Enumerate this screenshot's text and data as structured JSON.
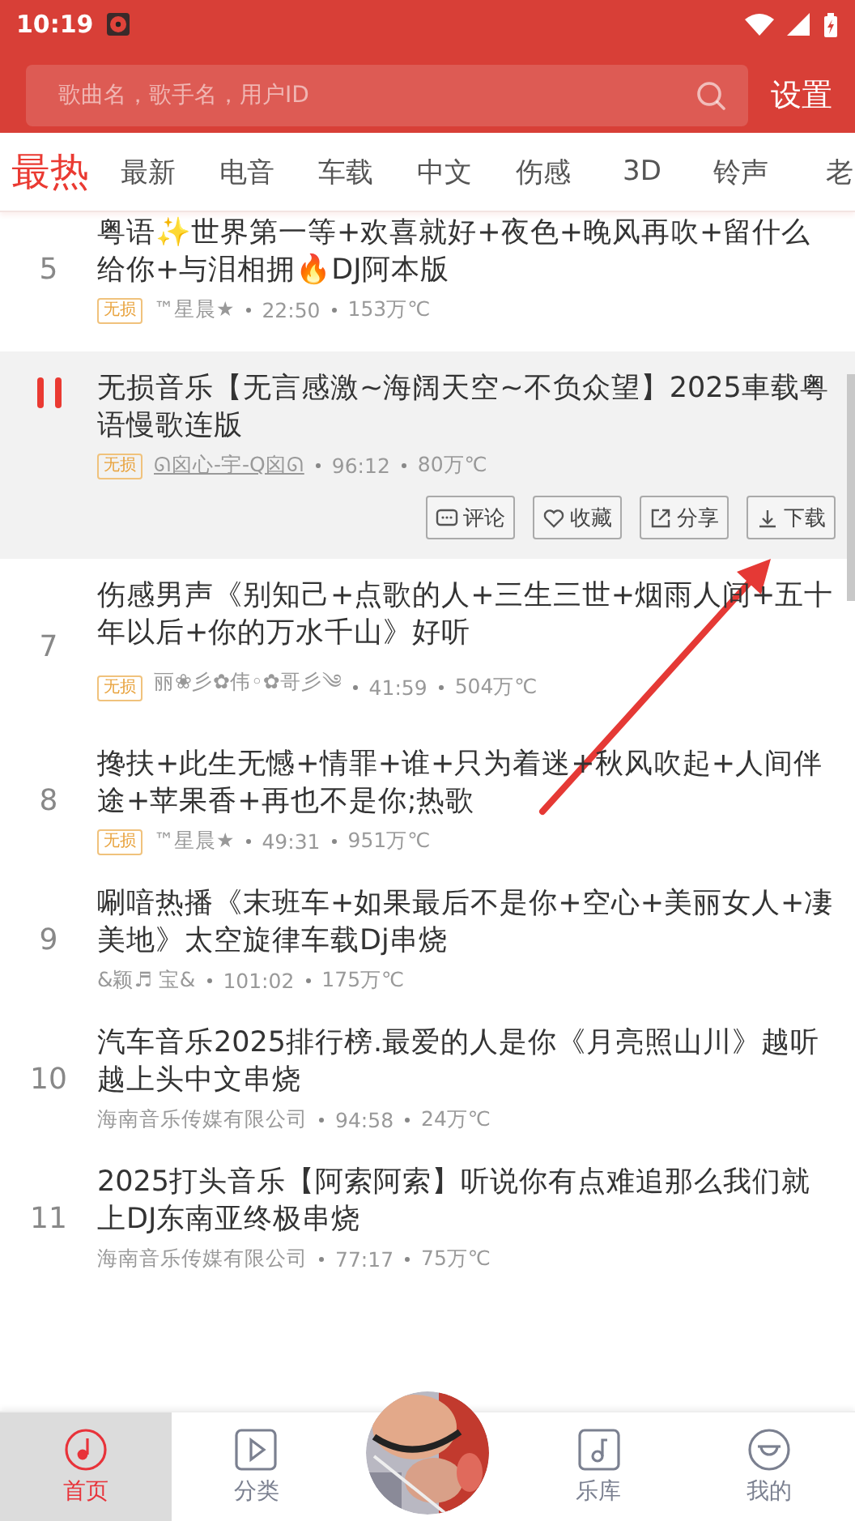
{
  "status_bar": {
    "time": "10:19"
  },
  "search": {
    "placeholder": "歌曲名，歌手名，用户ID",
    "action": "设置"
  },
  "tabs": [
    {
      "label": "最热",
      "selected": true
    },
    {
      "label": "最新",
      "selected": false
    },
    {
      "label": "电音",
      "selected": false
    },
    {
      "label": "车载",
      "selected": false
    },
    {
      "label": "中文",
      "selected": false
    },
    {
      "label": "伤感",
      "selected": false
    },
    {
      "label": "3D",
      "selected": false
    },
    {
      "label": "铃声",
      "selected": false
    },
    {
      "label": "老",
      "selected": false
    }
  ],
  "songs": [
    {
      "number": "5",
      "playing": false,
      "title": "粤语✨世界第一等+欢喜就好+夜色+晚风再吹+留什么给你+与泪相拥🔥DJ阿本版",
      "lossless": "无损",
      "uploader": "™星晨★",
      "duration": "22:50",
      "heat": "153万℃"
    },
    {
      "playing": true,
      "title": "无损音乐【无言感激~海阔天空~不负众望】2025車载粤语慢歌连版",
      "lossless": "无损",
      "uploader": "ᘏ囟心-宇-Q囟ᘏ",
      "duration": "96:12",
      "heat": "80万℃",
      "actions": [
        {
          "kind": "comment",
          "label": "评论"
        },
        {
          "kind": "heart",
          "label": "收藏"
        },
        {
          "kind": "share",
          "label": "分享"
        },
        {
          "kind": "download",
          "label": "下载"
        }
      ]
    },
    {
      "number": "7",
      "playing": false,
      "title": "伤感男声《别知己+点歌的人+三生三世+烟雨人间+五十年以后+你的万水千山》好听",
      "lossless": "无损",
      "uploader": "丽❀彡✿伟◦✿哥彡༄",
      "duration": "41:59",
      "heat": "504万℃"
    },
    {
      "number": "8",
      "playing": false,
      "title": "搀扶+此生无憾+情罪+谁+只为着迷+秋风吹起+人间伴途+苹果香+再也不是你;热歌",
      "lossless": "无损",
      "uploader": "™星晨★",
      "duration": "49:31",
      "heat": "951万℃"
    },
    {
      "number": "9",
      "playing": false,
      "title": "唰喑热播《末班车+如果最后不是你+空心+美丽女人+凄美地》太空旋律车载Dj串烧",
      "uploader": "&颖♬ 宝&",
      "duration": "101:02",
      "heat": "175万℃"
    },
    {
      "number": "10",
      "playing": false,
      "title": "汽车音乐2025排行榜.最爱的人是你《月亮照山川》越听越上头中文串烧",
      "uploader": "海南音乐传媒有限公司",
      "duration": "94:58",
      "heat": "24万℃"
    },
    {
      "number": "11",
      "playing": false,
      "title": "2025打头音乐【阿索阿索】听说你有点难追那么我们就上DJ东南亚终极串烧",
      "uploader": "海南音乐传媒有限公司",
      "duration": "77:17",
      "heat": "75万℃"
    }
  ],
  "nav": [
    {
      "kind": "home",
      "label": "首页",
      "selected": true
    },
    {
      "kind": "category",
      "label": "分类",
      "selected": false
    },
    {
      "kind": "picture"
    },
    {
      "kind": "library",
      "label": "乐库",
      "selected": false
    },
    {
      "kind": "mine",
      "label": "我的",
      "selected": false
    }
  ]
}
